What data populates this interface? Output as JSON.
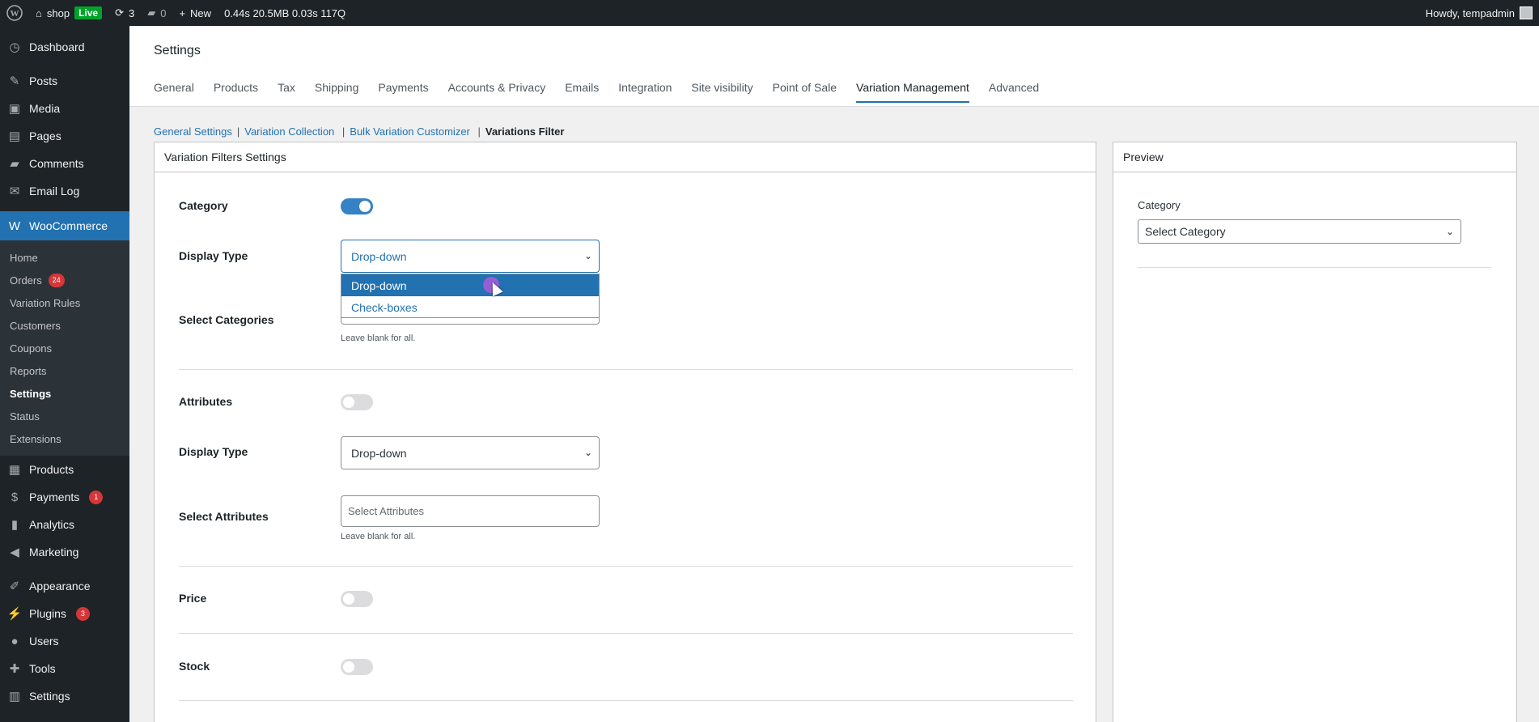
{
  "adminbar": {
    "site_name": "shop",
    "live_badge": "Live",
    "updates_count": "3",
    "comments_count": "0",
    "new_label": "New",
    "stats": "0.44s  20.5MB  0.03s  117Q",
    "howdy": "Howdy, tempadmin"
  },
  "sidebar": {
    "top_items": [
      {
        "label": "Dashboard",
        "icon": "dashboard-icon"
      },
      {
        "label": "Posts",
        "icon": "pin-icon"
      },
      {
        "label": "Media",
        "icon": "media-icon"
      },
      {
        "label": "Pages",
        "icon": "pages-icon"
      },
      {
        "label": "Comments",
        "icon": "comment-icon"
      },
      {
        "label": "Email Log",
        "icon": "email-icon"
      }
    ],
    "woo_label": "WooCommerce",
    "woo_sub": [
      {
        "label": "Home"
      },
      {
        "label": "Orders",
        "badge": "24"
      },
      {
        "label": "Variation Rules"
      },
      {
        "label": "Customers"
      },
      {
        "label": "Coupons"
      },
      {
        "label": "Reports"
      },
      {
        "label": "Settings"
      },
      {
        "label": "Status"
      },
      {
        "label": "Extensions"
      }
    ],
    "bottom_items": [
      {
        "label": "Products",
        "icon": "products-icon"
      },
      {
        "label": "Payments",
        "icon": "payments-icon",
        "badge": "1"
      },
      {
        "label": "Analytics",
        "icon": "analytics-icon"
      },
      {
        "label": "Marketing",
        "icon": "megaphone-icon"
      },
      {
        "label": "Appearance",
        "icon": "brush-icon"
      },
      {
        "label": "Plugins",
        "icon": "plugin-icon",
        "badge": "3"
      },
      {
        "label": "Users",
        "icon": "users-icon"
      },
      {
        "label": "Tools",
        "icon": "wrench-icon"
      },
      {
        "label": "Settings",
        "icon": "settings-icon"
      }
    ]
  },
  "header": {
    "title": "Settings",
    "tabs": [
      "General",
      "Products",
      "Tax",
      "Shipping",
      "Payments",
      "Accounts & Privacy",
      "Emails",
      "Integration",
      "Site visibility",
      "Point of Sale",
      "Variation Management",
      "Advanced"
    ],
    "active_tab": "Variation Management"
  },
  "subnav": {
    "items": [
      "General Settings",
      "Variation Collection",
      "Bulk Variation Customizer"
    ],
    "current": "Variations Filter"
  },
  "main": {
    "title": "Variation Filters Settings",
    "category_label": "Category",
    "category_enabled": true,
    "display_type_label": "Display Type",
    "display_type_value": "Drop-down",
    "display_options": [
      "Drop-down",
      "Check-boxes"
    ],
    "select_categories_label": "Select Categories",
    "leave_blank": "Leave blank for all.",
    "attributes_label": "Attributes",
    "attributes_enabled": false,
    "attr_display_type_label": "Display Type",
    "attr_display_type_value": "Drop-down",
    "select_attributes_label": "Select Attributes",
    "select_attributes_placeholder": "Select Attributes",
    "attr_leave_blank": "Leave blank for all.",
    "price_label": "Price",
    "price_enabled": false,
    "stock_label": "Stock",
    "stock_enabled": false
  },
  "preview": {
    "title": "Preview",
    "category_label": "Category",
    "select_value": "Select Category"
  }
}
